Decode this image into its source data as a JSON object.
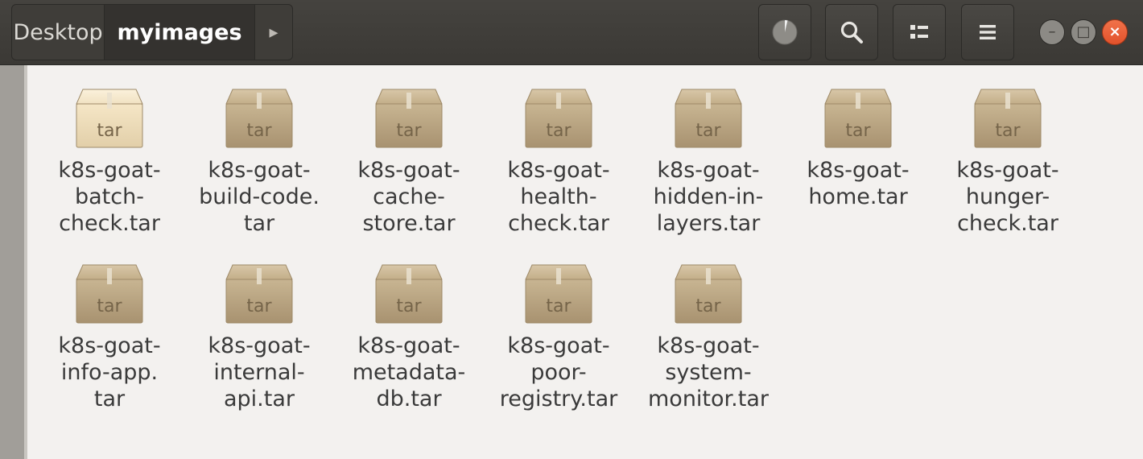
{
  "headerbar": {
    "breadcrumbs": [
      {
        "label": "Desktop"
      },
      {
        "label": "myimages"
      }
    ],
    "next_arrow": "▸",
    "buttons": {
      "disk_usage": "disk-usage-icon",
      "search": "search-icon",
      "view_toggle": "view-list-icon",
      "menu": "menu-icon"
    },
    "window_controls": {
      "minimize": "–",
      "maximize": "□",
      "close": "×"
    }
  },
  "icon_badge": "tar",
  "files": [
    {
      "name": "k8s-goat-\nbatch-\ncheck.tar",
      "selected": true
    },
    {
      "name": "k8s-goat-\nbuild-code.\ntar"
    },
    {
      "name": "k8s-goat-\ncache-\nstore.tar"
    },
    {
      "name": "k8s-goat-\nhealth-\ncheck.tar"
    },
    {
      "name": "k8s-goat-\nhidden-in-\nlayers.tar"
    },
    {
      "name": "k8s-goat-\nhome.tar"
    },
    {
      "name": "k8s-goat-\nhunger-\ncheck.tar"
    },
    {
      "name": "k8s-goat-\ninfo-app.\ntar"
    },
    {
      "name": "k8s-goat-\ninternal-\napi.tar"
    },
    {
      "name": "k8s-goat-\nmetadata-\ndb.tar"
    },
    {
      "name": "k8s-goat-\npoor-\nregistry.tar"
    },
    {
      "name": "k8s-goat-\nsystem-\nmonitor.tar"
    }
  ]
}
